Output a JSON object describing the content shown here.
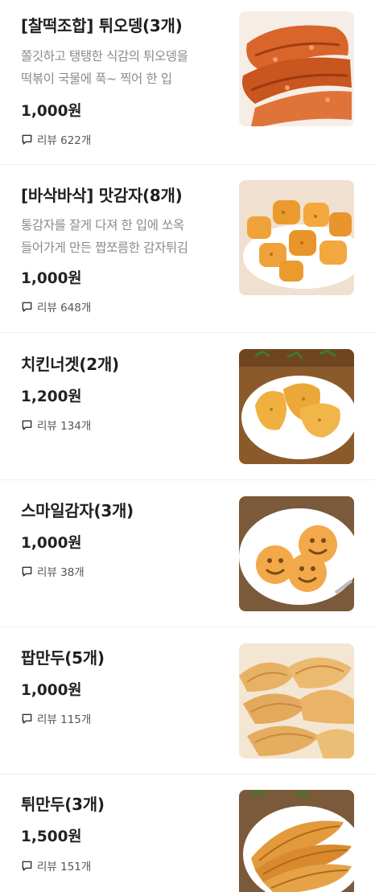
{
  "menu": {
    "items": [
      {
        "title": "[찰떡조합] 튀오뎅(3개)",
        "desc_line1": "쫄깃하고 탱탱한 식감의 튀오뎅을",
        "desc_line2": "떡볶이 국물에 푹~ 찍어 한 입",
        "price": "1,000원",
        "review_label": "리뷰 622개",
        "image_icon": "fried-fishcake-image"
      },
      {
        "title": "[바삭바삭] 맛감자(8개)",
        "desc_line1": "통감자를 잘게 다져 한 입에 쏘옥",
        "desc_line2": "들어가게 만든 짭쪼름한 감자튀김",
        "price": "1,000원",
        "review_label": "리뷰 648개",
        "image_icon": "potato-bites-image"
      },
      {
        "title": "치킨너겟(2개)",
        "price": "1,200원",
        "review_label": "리뷰 134개",
        "image_icon": "chicken-nugget-image"
      },
      {
        "title": "스마일감자(3개)",
        "price": "1,000원",
        "review_label": "리뷰 38개",
        "image_icon": "smile-potato-image"
      },
      {
        "title": "팝만두(5개)",
        "price": "1,000원",
        "review_label": "리뷰 115개",
        "image_icon": "pop-dumpling-image"
      },
      {
        "title": "튀만두(3개)",
        "price": "1,500원",
        "review_label": "리뷰 151개",
        "image_icon": "fried-dumpling-image"
      }
    ]
  },
  "icons": {
    "review": "speech-bubble-icon"
  },
  "colors": {
    "title": "#1f1f1f",
    "description": "#8a8a8a",
    "divider": "#eeeeee"
  }
}
